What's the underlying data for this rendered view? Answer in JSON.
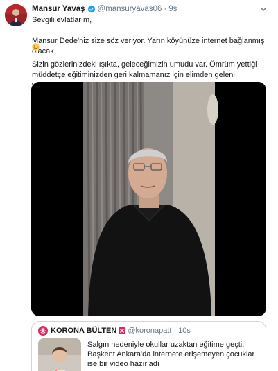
{
  "tweet": {
    "author_name": "Mansur Yavaş",
    "author_handle": "@mansuryavas06",
    "separator": "·",
    "time": "9s",
    "lines": {
      "greeting": "Sevgili evlatlarım,",
      "promise": "Mansur Dede'niz size söz veriyor. Yarın köyünüze internet bağlanmış olacak.",
      "message": "Sizin gözlerinizdeki ışıkta, geleceğimizin umudu var. Ömrüm yettiği müddetçe eğitiminizden geri kalmamanız için elimden geleni yapacağım."
    },
    "emoji": "smiling-face-emoji",
    "media": "video"
  },
  "quote": {
    "author_name": "KORONA BÜLTEN",
    "author_handle": "@koronapatt",
    "separator": "·",
    "time": "10s",
    "text": "Salgın nedeniyle okullar uzaktan eğitime geçti: Başkent Ankara'da internete erişemeyen çocuklar ise bir video hazırladı"
  },
  "colors": {
    "text": "#14171a",
    "secondary": "#657786",
    "verified_blue": "#1da1f2",
    "border": "#ccd6dd",
    "quote_badge": "#e0245e"
  },
  "icons": [
    "verified-badge-icon",
    "caret-down-icon",
    "corona-bulletin-logo-icon",
    "corona-alert-badge-icon"
  ]
}
